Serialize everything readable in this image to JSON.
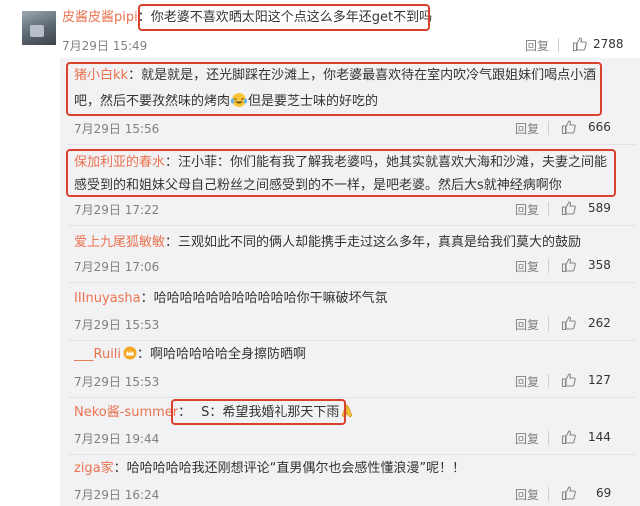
{
  "comments": [
    {
      "user": "皮酱皮酱pipi",
      "text": "你老婆不喜欢晒太阳这个点这么多年还get不到吗",
      "time": "7月29日 15:49",
      "reply": "回复",
      "likes": "2788"
    },
    {
      "user": "猪小白kk",
      "line1": "就是就是，还光脚踩在沙滩上，你老婆最喜欢待在室内吹冷气跟姐妹们喝点小酒",
      "line2a": "吧，然后不要孜然味的烤肉",
      "emoji": "laughing-crying-emoji",
      "line2b": "但是要芝士味的好吃的",
      "time": "7月29日 15:56",
      "reply": "回复",
      "likes": "666"
    },
    {
      "user": "保加利亚的春水",
      "line1": "汪小菲：你们能有我了解我老婆吗，她其实就喜欢大海和沙滩，夫妻之间能",
      "line2": "感受到的和姐妹父母自己粉丝之间感受到的不一样，是吧老婆。然后大s就神经病啊你",
      "time": "7月29日 17:22",
      "reply": "回复",
      "likes": "589"
    },
    {
      "user": "爱上九尾狐敏敏",
      "text": "三观如此不同的俩人却能携手走过这么多年，真真是给我们莫大的鼓励",
      "time": "7月29日 17:06",
      "reply": "回复",
      "likes": "358"
    },
    {
      "user": "IIInuyasha",
      "text": "哈哈哈哈哈哈哈哈哈哈哈你干嘛破坏气氛",
      "time": "7月29日 15:53",
      "reply": "回复",
      "likes": "262"
    },
    {
      "user": "___Ruili",
      "text": "啊哈哈哈哈哈全身擦防晒啊",
      "time": "7月29日 15:53",
      "reply": "回复",
      "likes": "127"
    },
    {
      "user": "Neko酱-summer",
      "text": "S：希望我婚礼那天下雨",
      "emoji": "praying-hands-emoji",
      "time": "7月29日 19:44",
      "reply": "回复",
      "likes": "144"
    },
    {
      "user": "ziga家",
      "text": "哈哈哈哈哈我还刚想评论“直男偶尔也会感性懂浪漫”呢！！",
      "time": "7月29日 16:24",
      "reply": "回复",
      "likes": "69"
    }
  ],
  "colors": {
    "username": "#eb7350",
    "highlight_box": "#d8412f",
    "reply_panel": "#f2f2f5"
  },
  "icons": {
    "like": "thumbs-up-icon"
  }
}
